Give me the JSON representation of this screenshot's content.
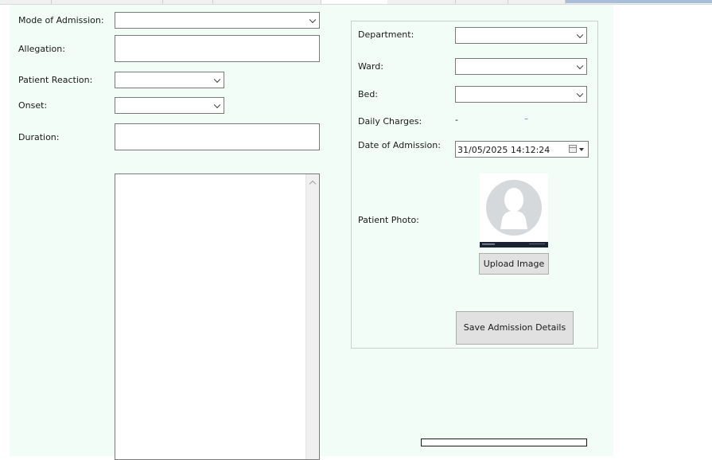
{
  "colors": {
    "panel_bg": "#f1fdf6",
    "daily_charges_value": "#1a1a1a",
    "daily_charges_currency": "#2f7fbf",
    "progress_fill": "#06b025"
  },
  "left": {
    "mode_of_admission": {
      "label": "Mode of Admission:",
      "value": ""
    },
    "allegation": {
      "label": "Allegation:",
      "value": ""
    },
    "patient_reaction": {
      "label": "Patient Reaction:",
      "value": ""
    },
    "onset": {
      "label": "Onset:",
      "value": ""
    },
    "duration": {
      "label": "Duration:",
      "value": ""
    },
    "notes": {
      "value": ""
    }
  },
  "right": {
    "department": {
      "label": "Department:",
      "value": ""
    },
    "ward": {
      "label": "Ward:",
      "value": ""
    },
    "bed": {
      "label": "Bed:",
      "value": ""
    },
    "daily_charges": {
      "label": "Daily Charges:",
      "value": "-",
      "currency": "–"
    },
    "date_of_admission": {
      "label": "Date of Admission:",
      "value": "31/05/2025 14:12:24"
    },
    "patient_photo": {
      "label": "Patient Photo:"
    },
    "upload_button": "Upload Image",
    "save_button": "Save Admission Details"
  },
  "progress": {
    "fraction": 0
  }
}
